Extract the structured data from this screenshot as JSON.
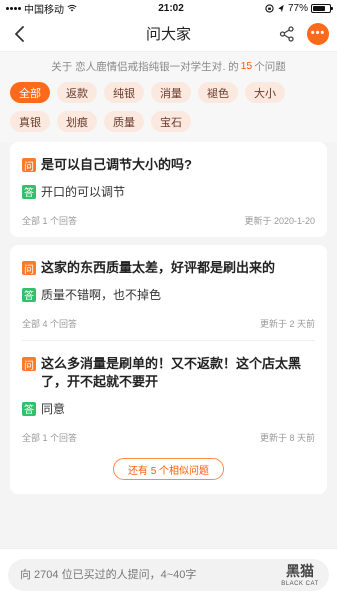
{
  "status": {
    "carrier": "中国移动",
    "time": "21:02",
    "battery_text": "77%",
    "battery_level": 0.77
  },
  "nav": {
    "title": "问大家"
  },
  "summary": {
    "prefix": "关于",
    "product": "恋人鹿情侣戒指纯银一对学生对…",
    "middle": "的",
    "count": "15",
    "suffix": "个问题"
  },
  "tags": [
    "全部",
    "返款",
    "纯银",
    "消量",
    "褪色",
    "大小",
    "真银",
    "划痕",
    "质量",
    "宝石"
  ],
  "cards": [
    {
      "items": [
        {
          "q_badge": "问",
          "question": "是可以自己调节大小的吗?",
          "a_badge": "答",
          "answer": "开口的可以调节",
          "answers_count": "全部 1 个回答",
          "updated": "更新于 2020-1-20"
        }
      ]
    },
    {
      "items": [
        {
          "q_badge": "问",
          "question": "这家的东西质量太差，好评都是刷出来的",
          "a_badge": "答",
          "answer": "质量不错啊，也不掉色",
          "answers_count": "全部 4 个回答",
          "updated": "更新于 2 天前"
        },
        {
          "q_badge": "问",
          "question": "这么多消量是刷单的！又不返款！这个店太黑了，开不起就不要开",
          "a_badge": "答",
          "answer": "同意",
          "answers_count": "全部 1 个回答",
          "updated": "更新于 8 天前"
        }
      ],
      "more_label": "还有 5 个相似问题"
    }
  ],
  "bottom": {
    "placeholder": "向 2704 位已买过的人提问，4~40字"
  },
  "watermark": {
    "main": "黑猫",
    "sub": "BLACK CAT"
  },
  "colors": {
    "accent": "#ff6a1a",
    "answer_green": "#34c06a",
    "tag_bg": "#fbe9df"
  },
  "icons": {
    "back": "chevron-left-icon",
    "share": "share-icon",
    "more": "more-dots-icon"
  }
}
